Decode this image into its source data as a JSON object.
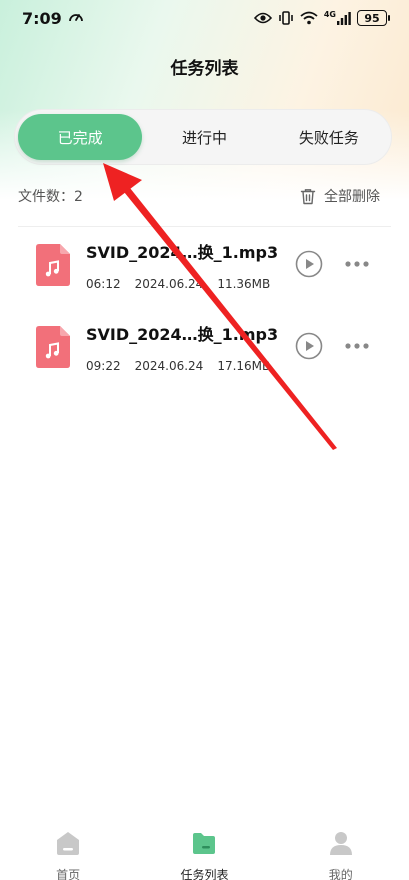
{
  "status_bar": {
    "time": "7:09",
    "network": "4G",
    "battery": "95"
  },
  "header": {
    "title": "任务列表"
  },
  "tabs": [
    {
      "label": "已完成",
      "active": true
    },
    {
      "label": "进行中",
      "active": false
    },
    {
      "label": "失败任务",
      "active": false
    }
  ],
  "file_info": {
    "count_label": "文件数：",
    "count": "2",
    "delete_all_label": "全部删除"
  },
  "files": [
    {
      "name": "SVID_2024…换_1.mp3",
      "duration": "06:12",
      "date": "2024.06.24",
      "size": "11.36MB"
    },
    {
      "name": "SVID_2024…换_1.mp3",
      "duration": "09:22",
      "date": "2024.06.24",
      "size": "17.16MB"
    }
  ],
  "bottom_nav": [
    {
      "label": "首页",
      "icon": "home-icon",
      "active": false
    },
    {
      "label": "任务列表",
      "icon": "folder-icon",
      "active": true
    },
    {
      "label": "我的",
      "icon": "user-icon",
      "active": false
    }
  ],
  "colors": {
    "accent": "#5cc58c",
    "file_icon": "#f2707a",
    "annotation_arrow": "#ee2222"
  }
}
